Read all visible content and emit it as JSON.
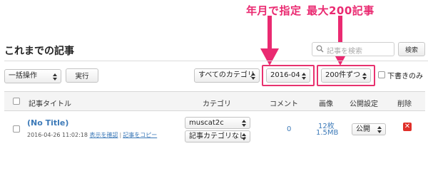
{
  "annotations": {
    "date_filter": "年月で指定",
    "max_posts": "最大200記事"
  },
  "page": {
    "title": "これまでの記事",
    "search_placeholder": "記事を検索",
    "search_button": "検索"
  },
  "toolbar": {
    "bulk_action": "一括操作",
    "apply_button": "実行",
    "category_filter": "すべてのカテゴリ",
    "month_filter": "2016-04",
    "per_page": "200件ずつ",
    "drafts_only_label": "下書きのみ"
  },
  "table": {
    "headers": {
      "title": "記事タイトル",
      "category": "カテゴリ",
      "comments": "コメント",
      "images": "画像",
      "visibility": "公開設定",
      "delete": "削除"
    },
    "rows": [
      {
        "title": "(No Title)",
        "datetime": "2016-04-26 11:02:18",
        "view_link": "表示を確認",
        "copy_link": "記事をコピー",
        "category_primary": "muscat2c",
        "category_secondary": "記事カテゴリなし",
        "comments": "0",
        "image_count": "12枚",
        "image_size": "1.5MB",
        "visibility": "公開"
      }
    ]
  },
  "colors": {
    "annotation": "#ea2a71",
    "link": "#3d7ab8",
    "delete": "#e0302a"
  }
}
